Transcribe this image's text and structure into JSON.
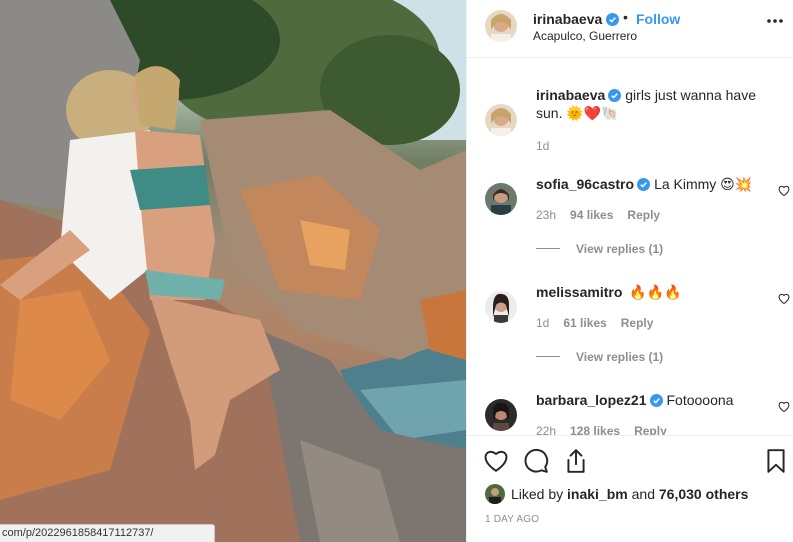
{
  "post": {
    "author": "irinabaeva",
    "follow_label": "Follow",
    "separator": "•",
    "location": "Acapulco, Guerrero"
  },
  "caption": {
    "username": "irinabaeva",
    "text": "girls just wanna have sun. 🌞❤️🐚",
    "time": "1d"
  },
  "comments": [
    {
      "username": "sofia_96castro",
      "text": "La Kimmy 😍💥",
      "time": "23h",
      "likes": "94 likes",
      "reply_label": "Reply",
      "view_replies": "View replies (1)"
    },
    {
      "username": "melissamitro",
      "text": "🔥🔥🔥",
      "time": "1d",
      "likes": "61 likes",
      "reply_label": "Reply",
      "view_replies": "View replies (1)"
    },
    {
      "username": "barbara_lopez21",
      "text": "Fotoooona",
      "time": "22h",
      "likes": "128 likes",
      "reply_label": "Reply"
    }
  ],
  "likes_line": {
    "prefix": "Liked by",
    "user": "inaki_bm",
    "joiner": "and",
    "others": "76,030 others"
  },
  "timestamp": "1 DAY AGO",
  "status_url": "com/p/2022961858417112737/",
  "icons": {
    "verified": "verified-badge-icon",
    "more": "more-options-icon",
    "like": "heart-icon",
    "comment": "comment-bubble-icon",
    "share": "share-icon",
    "save": "bookmark-icon"
  },
  "colors": {
    "follow": "#3897f0",
    "verified": "#3897f0",
    "muted": "#8e8e8e",
    "text": "#262626"
  }
}
